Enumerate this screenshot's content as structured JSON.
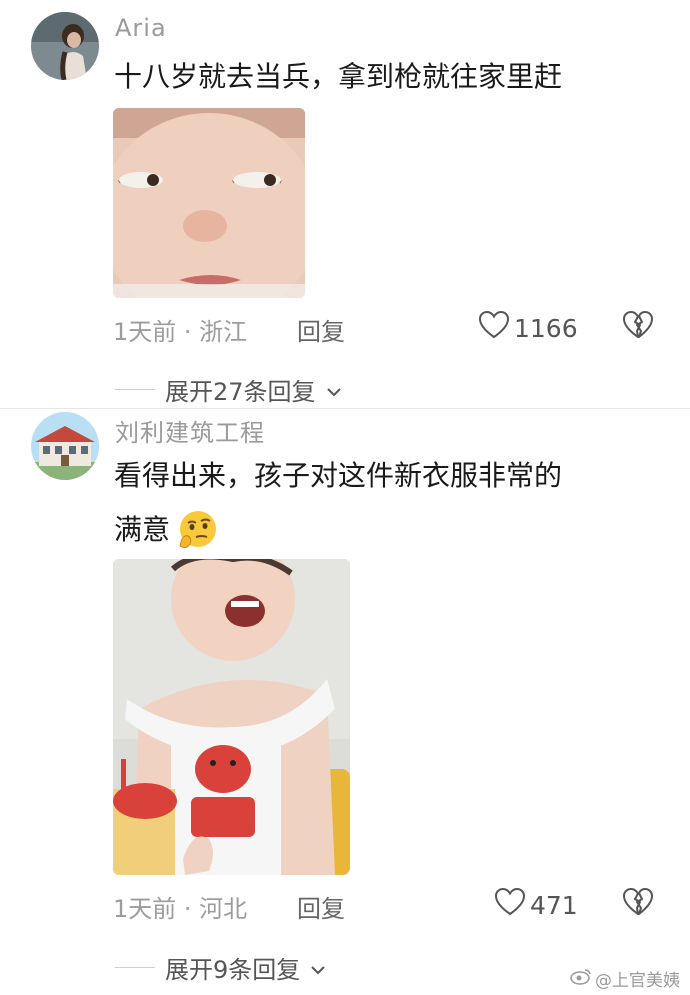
{
  "comments": [
    {
      "username": "Aria",
      "text_line1": "十八岁就去当兵，拿到枪就往家里赶",
      "time_location": "1天前 · 浙江",
      "reply_label": "回复",
      "likes": "1166",
      "expand_label": "展开27条回复"
    },
    {
      "username": "刘利建筑工程",
      "text_line1": "看得出来，孩子对这件新衣服非常的",
      "text_line2": "满意",
      "time_location": "1天前 · 河北",
      "reply_label": "回复",
      "likes": "471",
      "expand_label": "展开9条回复"
    }
  ],
  "watermark": "@上官美姨",
  "icons": [
    "heart-icon",
    "broken-heart-icon",
    "chevron-down-icon",
    "weibo-logo-icon",
    "thinking-face-emoji"
  ]
}
